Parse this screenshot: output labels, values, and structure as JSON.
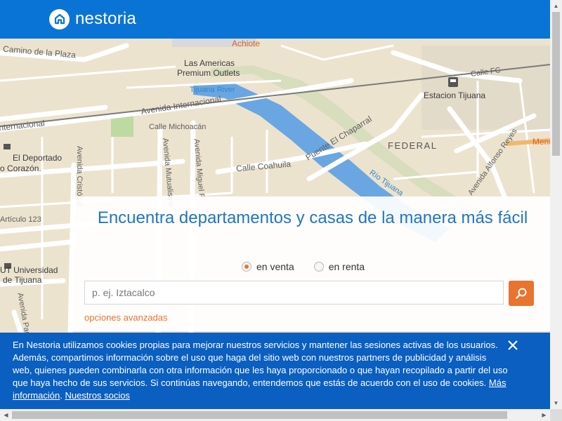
{
  "header": {
    "brand": "nestoria",
    "logo_icon": "house-icon",
    "bg_color": "#0a74d6"
  },
  "map": {
    "labels": {
      "achiote": "Achiote",
      "camino": "Camino de la Plaza",
      "las_americas": "Las Americas",
      "premium": "Premium Outlets",
      "tijuana_river": "Tijuana River",
      "calle_fc": "Calle FC",
      "estacion": "Estacion Tijuana",
      "av_internacional": "Avenida Internacional",
      "internacional": "Internacional",
      "calle_michoacan": "Calle Michoacán",
      "deportado_1": "El Deportado",
      "deportado_2": "o Corazón.",
      "av_cristo": "Avenida Cristóbal",
      "av_mutualismo": "Avenida Mutualismo",
      "av_miguel": "Avenida Miguel F.",
      "calle_coahuila": "Calle Coahuila",
      "puente": "Puente El Chaparral",
      "federal": "FEDERAL",
      "rio_tijuana": "Río Tijuana",
      "av_alfonso": "Avenida Alfonso Reyes",
      "menu": "Menu",
      "articulo": "Artículo 123",
      "ut_1": "UT Universidad",
      "ut_2": "de Tijuana",
      "av_paris": "Avenida París"
    }
  },
  "search": {
    "title": "Encuentra departamentos y casas de la manera más fácil",
    "radio_sale": "en venta",
    "radio_rent": "en renta",
    "selected": "en venta",
    "placeholder": "p. ej. Iztacalco",
    "button_icon": "search-icon",
    "advanced": "opciones avanzadas",
    "accent": "#e8742f",
    "title_color": "#1f76c2"
  },
  "cookie": {
    "text": "En Nestoria utilizamos cookies propias para mejorar nuestros servicios y mantener las sesiones activas de los usuarios. Además, compartimos información sobre el uso que haga del sitio web con nuestros partners de publicidad y análisis web, quienes pueden combinarla con otra información que les haya proporcionado o que hayan recopilado a partir del uso que haya hecho de sus servicios. Si continúas navegando, entendemos que estás de acuerdo con el uso de cookies.",
    "more_info": "Más información",
    "separator": ".",
    "partners": "Nuestros socios",
    "close_icon": "close-icon",
    "bg_color": "#0a5fc0"
  }
}
